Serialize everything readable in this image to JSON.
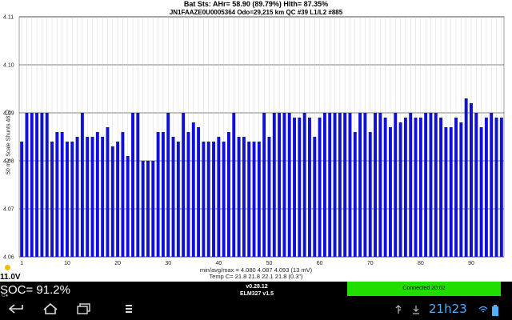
{
  "header": {
    "line1": "Bat Sts:  AHr= 58.90 (89.79%) Hlth= 87.35%",
    "line2": "JN1FAAZE0U0005364 Odo=29,215 km  QC #39  L1/L2 #885"
  },
  "chart_data": {
    "type": "bar",
    "ylabel": "50 mV Scale  Shunts 4812",
    "ylim": [
      4.06,
      4.11
    ],
    "yticks": [
      "4.11",
      "4.10",
      "4.09",
      "4.08",
      "4.07",
      "4.06"
    ],
    "xticks": [
      "1",
      "10",
      "20",
      "30",
      "40",
      "50",
      "60",
      "70",
      "80",
      "90"
    ],
    "xtick_values": [
      1,
      10,
      20,
      30,
      40,
      50,
      60,
      70,
      80,
      90
    ],
    "grid": true,
    "bar_color": "#1010d8",
    "values": [
      4.084,
      4.09,
      4.09,
      4.09,
      4.09,
      4.09,
      4.084,
      4.086,
      4.086,
      4.084,
      4.084,
      4.085,
      4.09,
      4.085,
      4.085,
      4.086,
      4.085,
      4.087,
      4.083,
      4.084,
      4.086,
      4.081,
      4.09,
      4.09,
      4.08,
      4.08,
      4.08,
      4.086,
      4.086,
      4.09,
      4.085,
      4.084,
      4.09,
      4.086,
      4.088,
      4.087,
      4.084,
      4.084,
      4.084,
      4.085,
      4.084,
      4.086,
      4.09,
      4.085,
      4.085,
      4.084,
      4.084,
      4.084,
      4.09,
      4.085,
      4.09,
      4.09,
      4.09,
      4.09,
      4.089,
      4.089,
      4.09,
      4.089,
      4.085,
      4.089,
      4.09,
      4.09,
      4.09,
      4.09,
      4.09,
      4.09,
      4.086,
      4.09,
      4.09,
      4.086,
      4.09,
      4.09,
      4.089,
      4.087,
      4.09,
      4.088,
      4.089,
      4.09,
      4.089,
      4.089,
      4.09,
      4.09,
      4.09,
      4.089,
      4.087,
      4.087,
      4.089,
      4.088,
      4.093,
      4.092,
      4.09,
      4.087,
      4.089,
      4.09,
      4.089,
      4.089
    ]
  },
  "footer": {
    "stats": "min/avg/max = 4.080 4.087 4.093  (13 mV)",
    "temp": "Temp C= 21.8  21.8  22.1  21.8  (0.3\")"
  },
  "lower_bar": {
    "voltage": "11.0V",
    "soc": "SOC= 91.2%",
    "soc_sub": "G●",
    "version": "v0.28.12",
    "adapter": "ELM327 v1.5",
    "connected": "Connected 20:02"
  },
  "system_bar": {
    "clock": "21h23",
    "nav_icons": [
      "back-icon",
      "home-icon",
      "recent-apps-icon",
      "menu-icon"
    ]
  }
}
